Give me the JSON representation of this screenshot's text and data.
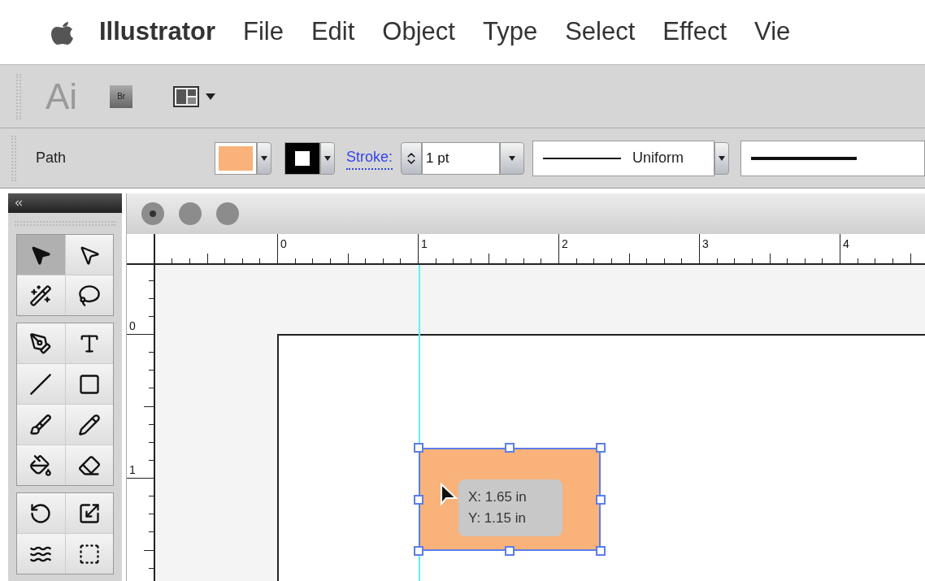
{
  "menu_bar": {
    "app_name": "Illustrator",
    "items": [
      "File",
      "Edit",
      "Object",
      "Type",
      "Select",
      "Effect",
      "Vie"
    ]
  },
  "app_bar": {
    "logo": "Ai",
    "bridge_button": "Br"
  },
  "control_bar": {
    "selection_label": "Path",
    "stroke_label": "Stroke:",
    "stroke_weight": "1 pt",
    "variable_width_profile": "Uniform"
  },
  "tools_panel": {
    "groups": [
      {
        "tools": [
          {
            "selected": true
          },
          {
            "selected": false
          },
          {
            "selected": false
          },
          {
            "selected": false
          }
        ]
      },
      {
        "tools": [
          {
            "selected": false
          },
          {
            "selected": false
          },
          {
            "selected": false
          },
          {
            "selected": false
          },
          {
            "selected": false
          },
          {
            "selected": false
          },
          {
            "selected": false
          },
          {
            "selected": false
          }
        ]
      },
      {
        "tools": [
          {
            "selected": false
          },
          {
            "selected": false
          },
          {
            "selected": false
          },
          {
            "selected": false
          }
        ]
      }
    ]
  },
  "document": {
    "horizontal_ruler": [
      "0",
      "1",
      "2",
      "3",
      "4"
    ],
    "vertical_ruler": [
      "0",
      "1"
    ],
    "tooltip": {
      "x": "X: 1.65 in",
      "y": "Y: 1.15 in"
    }
  }
}
